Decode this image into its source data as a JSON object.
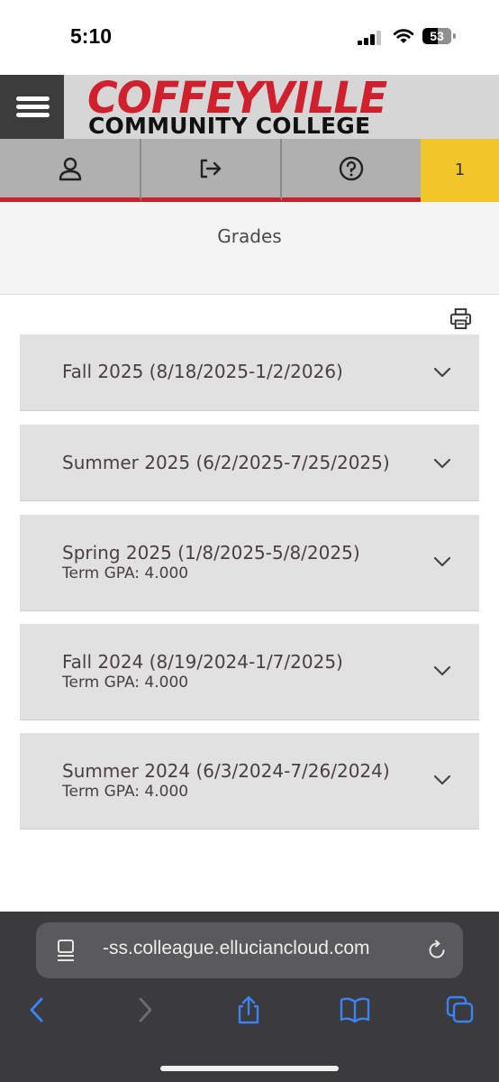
{
  "status_bar": {
    "time": "5:10",
    "battery": "53",
    "battery_level": 0.53
  },
  "header": {
    "logo_line1": "COFFEYVILLE",
    "logo_line2": "COMMUNITY COLLEGE",
    "menu_icon": "hamburger-menu-icon"
  },
  "nav": {
    "tabs": [
      {
        "icon": "user-icon"
      },
      {
        "icon": "sign-out-icon"
      },
      {
        "icon": "help-icon"
      },
      {
        "icon": "notifications",
        "badge": "1"
      }
    ]
  },
  "page": {
    "title": "Grades",
    "print_icon": "print-icon"
  },
  "terms": [
    {
      "title": "Fall 2025 (8/18/2025-1/2/2026)",
      "gpa": ""
    },
    {
      "title": "Summer 2025 (6/2/2025-7/25/2025)",
      "gpa": ""
    },
    {
      "title": "Spring 2025 (1/8/2025-5/8/2025)",
      "gpa": "Term GPA: 4.000"
    },
    {
      "title": "Fall 2024 (8/19/2024-1/7/2025)",
      "gpa": "Term GPA: 4.000"
    },
    {
      "title": "Summer 2024 (6/3/2024-7/26/2024)",
      "gpa": "Term GPA: 4.000"
    }
  ],
  "browser": {
    "url": "-ss.colleague.elluciancloud.com",
    "toolbar_icons": [
      "back-icon",
      "forward-icon",
      "share-icon",
      "bookmarks-icon",
      "tabs-icon"
    ]
  },
  "colors": {
    "accent_red": "#d0202e",
    "notification_yellow": "#f1c62a",
    "browser_blue": "#3b82f6"
  }
}
